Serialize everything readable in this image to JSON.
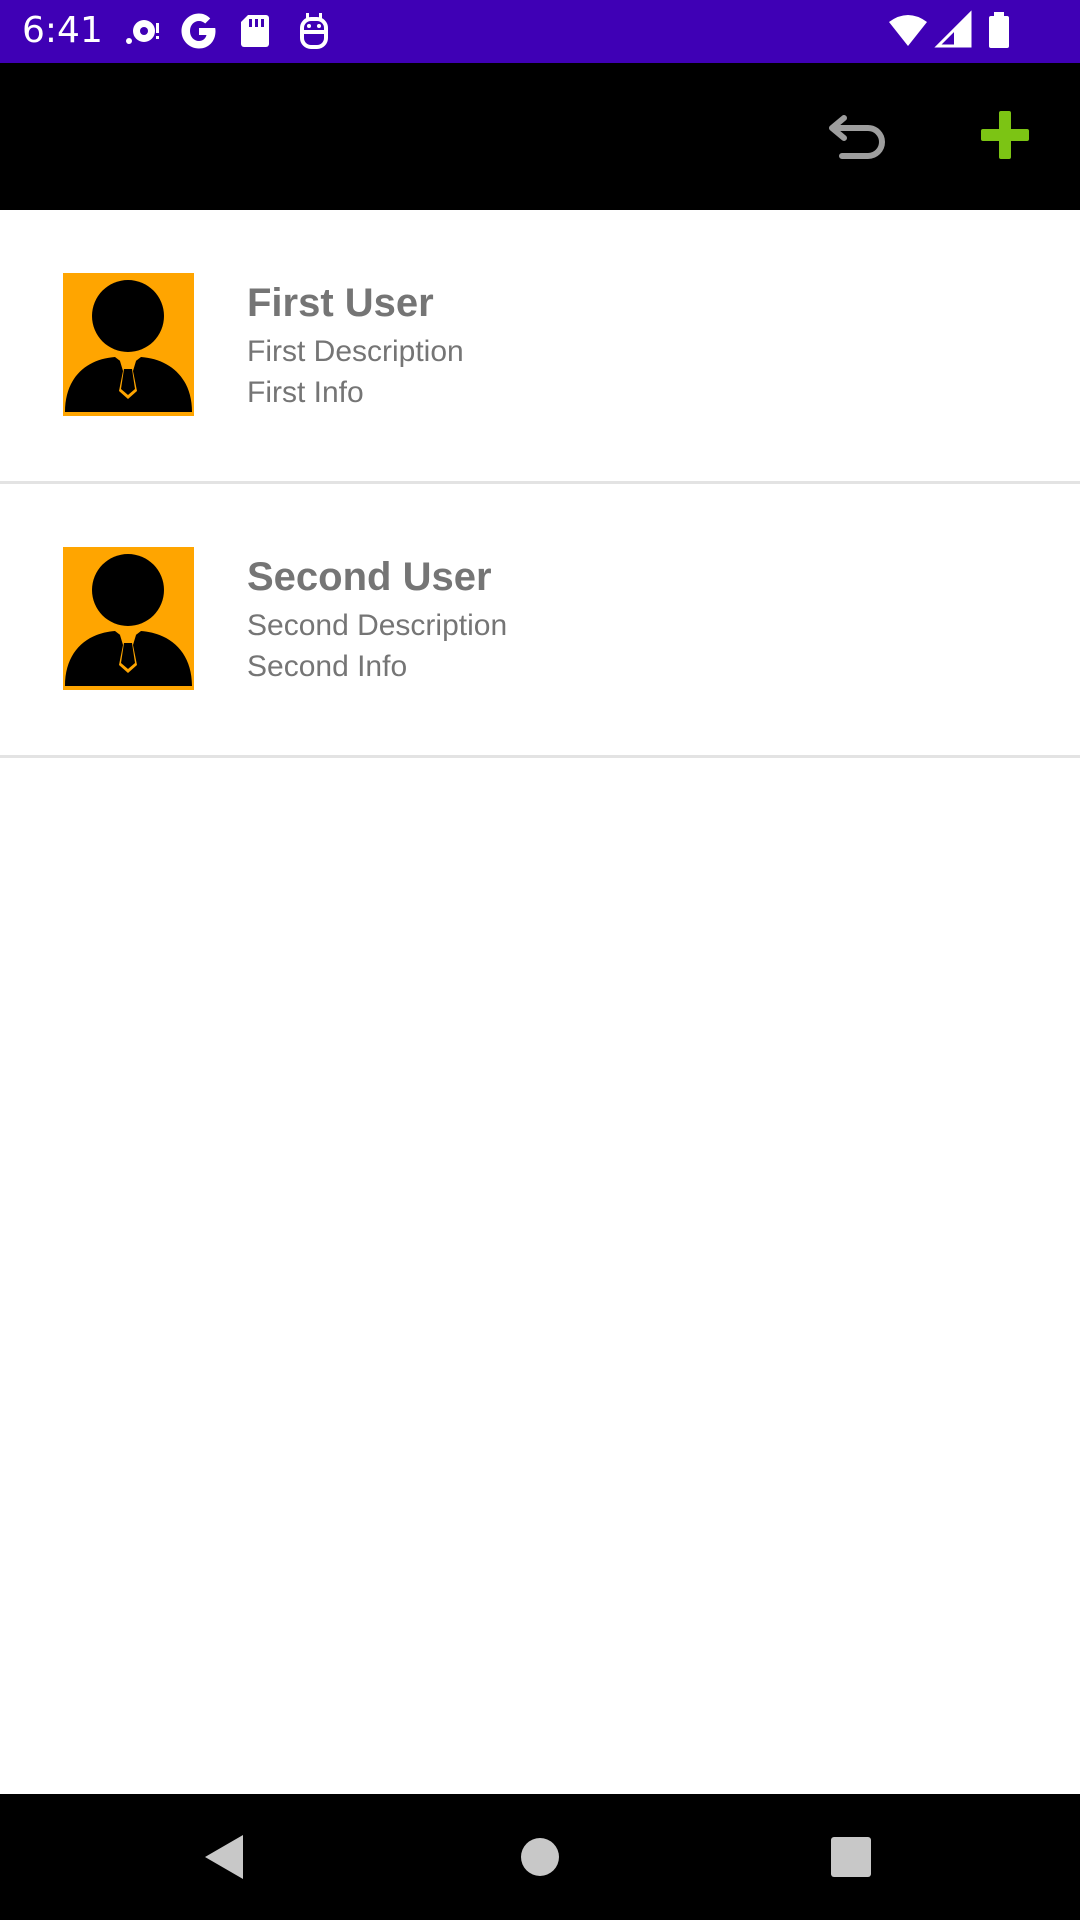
{
  "status_bar": {
    "time": "6:41",
    "icons": [
      "notification-icon",
      "google-icon",
      "sd-card-icon",
      "android-debug-icon",
      "wifi-icon",
      "signal-icon",
      "battery-icon"
    ],
    "background_color": "#3f00b5"
  },
  "toolbar": {
    "background_color": "#000000",
    "actions": [
      {
        "icon": "undo-icon",
        "color": "#9e9e9e"
      },
      {
        "icon": "add-icon",
        "color": "#7cc414"
      }
    ]
  },
  "users": [
    {
      "name": "First User",
      "description": "First Description",
      "info": "First Info",
      "avatar_icon": "user-avatar-icon"
    },
    {
      "name": "Second User",
      "description": "Second Description",
      "info": "Second Info",
      "avatar_icon": "user-avatar-icon"
    }
  ],
  "avatar_color": "#ffa500",
  "nav_bar": {
    "buttons": [
      "back-icon",
      "home-icon",
      "recents-icon"
    ],
    "icon_color": "#c8c8c8"
  }
}
